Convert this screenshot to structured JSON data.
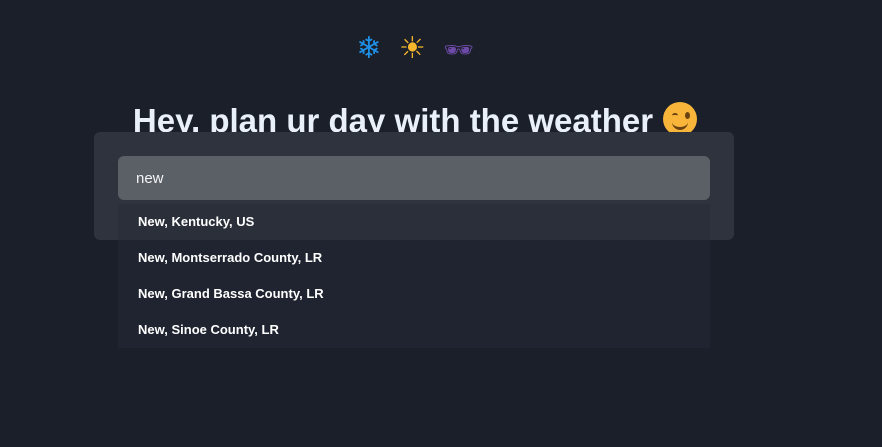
{
  "header": {
    "icons": [
      {
        "name": "snowflake-icon",
        "glyph": "❄"
      },
      {
        "name": "sun-icon",
        "glyph": "☀"
      },
      {
        "name": "sunglasses-icon",
        "glyph": "🕶"
      }
    ],
    "title": "Hey, plan ur day with the weather",
    "title_icon": "winking-face-icon"
  },
  "search": {
    "value": "new",
    "placeholder": ""
  },
  "suggestions": [
    "New, Kentucky, US",
    "New, Montserrado County, LR",
    "New, Grand Bassa County, LR",
    "New, Sinoe County, LR"
  ],
  "colors": {
    "background": "#1b1f29",
    "panel": "#2f333e",
    "input": "#5b5f66",
    "dropdown": "#1f2430",
    "highlight": "#2a2f3a"
  }
}
